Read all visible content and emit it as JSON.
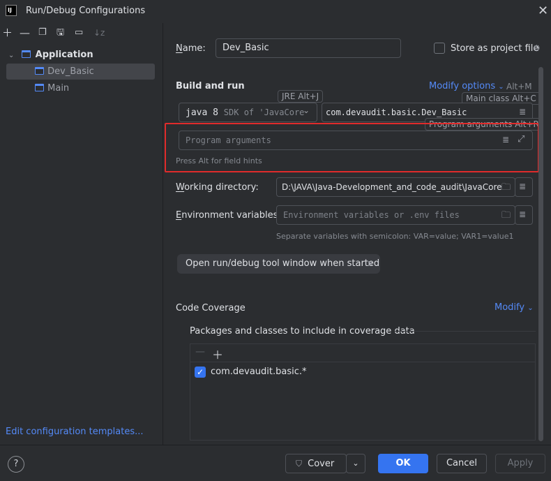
{
  "window": {
    "title": "Run/Debug Configurations",
    "app_icon_text": "IJ"
  },
  "tree": {
    "root_label": "Application",
    "items": [
      {
        "label": "Dev_Basic",
        "selected": true
      },
      {
        "label": "Main",
        "selected": false
      }
    ],
    "edit_templates_link": "Edit configuration templates..."
  },
  "form": {
    "name_label": "Name:",
    "name_value": "Dev_Basic",
    "store_label": "Store as project file",
    "store_checked": false,
    "build_and_run_title": "Build and run",
    "modify_options_label": "Modify options",
    "modify_options_shortcut": "Alt+M",
    "jre_tag": "JRE Alt+J",
    "main_class_tag": "Main class Alt+C",
    "program_args_tag": "Program arguments Alt+R",
    "sdk_value": "java 8",
    "sdk_suffix": "SDK of 'JavaCore",
    "main_class_value": "com.devaudit.basic.Dev_Basic",
    "program_args_placeholder": "Program arguments",
    "field_hints_text": "Press Alt for field hints",
    "working_dir_label": "Working directory:",
    "working_dir_value": "D:\\JAVA\\Java-Development_and_code_audit\\JavaCore",
    "env_vars_label": "Environment variables:",
    "env_vars_placeholder": "Environment variables or .env files",
    "env_hint": "Separate variables with semicolon: VAR=value; VAR1=value1",
    "open_tool_window_chip": "Open run/debug tool window when started",
    "code_coverage_title": "Code Coverage",
    "modify_label": "Modify",
    "packages_label": "Packages and classes to include in coverage data",
    "coverage_items": [
      {
        "label": "com.devaudit.basic.*",
        "checked": true
      }
    ]
  },
  "buttons": {
    "cover": "Cover",
    "ok": "OK",
    "cancel": "Cancel",
    "apply": "Apply",
    "help": "?"
  },
  "colors": {
    "accent": "#3574f0",
    "link": "#548af7",
    "highlight_border": "#e02b2b",
    "background": "#2b2d30"
  }
}
